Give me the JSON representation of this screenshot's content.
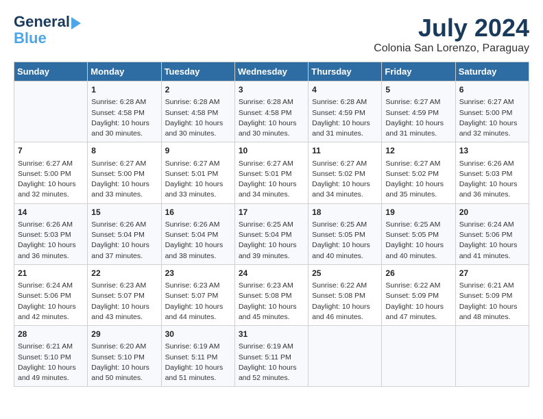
{
  "logo": {
    "line1": "General",
    "line2": "Blue"
  },
  "title": "July 2024",
  "location": "Colonia San Lorenzo, Paraguay",
  "days_of_week": [
    "Sunday",
    "Monday",
    "Tuesday",
    "Wednesday",
    "Thursday",
    "Friday",
    "Saturday"
  ],
  "weeks": [
    [
      {
        "day": "",
        "text": ""
      },
      {
        "day": "1",
        "text": "Sunrise: 6:28 AM\nSunset: 4:58 PM\nDaylight: 10 hours\nand 30 minutes."
      },
      {
        "day": "2",
        "text": "Sunrise: 6:28 AM\nSunset: 4:58 PM\nDaylight: 10 hours\nand 30 minutes."
      },
      {
        "day": "3",
        "text": "Sunrise: 6:28 AM\nSunset: 4:58 PM\nDaylight: 10 hours\nand 30 minutes."
      },
      {
        "day": "4",
        "text": "Sunrise: 6:28 AM\nSunset: 4:59 PM\nDaylight: 10 hours\nand 31 minutes."
      },
      {
        "day": "5",
        "text": "Sunrise: 6:27 AM\nSunset: 4:59 PM\nDaylight: 10 hours\nand 31 minutes."
      },
      {
        "day": "6",
        "text": "Sunrise: 6:27 AM\nSunset: 5:00 PM\nDaylight: 10 hours\nand 32 minutes."
      }
    ],
    [
      {
        "day": "7",
        "text": "Sunrise: 6:27 AM\nSunset: 5:00 PM\nDaylight: 10 hours\nand 32 minutes."
      },
      {
        "day": "8",
        "text": "Sunrise: 6:27 AM\nSunset: 5:00 PM\nDaylight: 10 hours\nand 33 minutes."
      },
      {
        "day": "9",
        "text": "Sunrise: 6:27 AM\nSunset: 5:01 PM\nDaylight: 10 hours\nand 33 minutes."
      },
      {
        "day": "10",
        "text": "Sunrise: 6:27 AM\nSunset: 5:01 PM\nDaylight: 10 hours\nand 34 minutes."
      },
      {
        "day": "11",
        "text": "Sunrise: 6:27 AM\nSunset: 5:02 PM\nDaylight: 10 hours\nand 34 minutes."
      },
      {
        "day": "12",
        "text": "Sunrise: 6:27 AM\nSunset: 5:02 PM\nDaylight: 10 hours\nand 35 minutes."
      },
      {
        "day": "13",
        "text": "Sunrise: 6:26 AM\nSunset: 5:03 PM\nDaylight: 10 hours\nand 36 minutes."
      }
    ],
    [
      {
        "day": "14",
        "text": "Sunrise: 6:26 AM\nSunset: 5:03 PM\nDaylight: 10 hours\nand 36 minutes."
      },
      {
        "day": "15",
        "text": "Sunrise: 6:26 AM\nSunset: 5:04 PM\nDaylight: 10 hours\nand 37 minutes."
      },
      {
        "day": "16",
        "text": "Sunrise: 6:26 AM\nSunset: 5:04 PM\nDaylight: 10 hours\nand 38 minutes."
      },
      {
        "day": "17",
        "text": "Sunrise: 6:25 AM\nSunset: 5:04 PM\nDaylight: 10 hours\nand 39 minutes."
      },
      {
        "day": "18",
        "text": "Sunrise: 6:25 AM\nSunset: 5:05 PM\nDaylight: 10 hours\nand 40 minutes."
      },
      {
        "day": "19",
        "text": "Sunrise: 6:25 AM\nSunset: 5:05 PM\nDaylight: 10 hours\nand 40 minutes."
      },
      {
        "day": "20",
        "text": "Sunrise: 6:24 AM\nSunset: 5:06 PM\nDaylight: 10 hours\nand 41 minutes."
      }
    ],
    [
      {
        "day": "21",
        "text": "Sunrise: 6:24 AM\nSunset: 5:06 PM\nDaylight: 10 hours\nand 42 minutes."
      },
      {
        "day": "22",
        "text": "Sunrise: 6:23 AM\nSunset: 5:07 PM\nDaylight: 10 hours\nand 43 minutes."
      },
      {
        "day": "23",
        "text": "Sunrise: 6:23 AM\nSunset: 5:07 PM\nDaylight: 10 hours\nand 44 minutes."
      },
      {
        "day": "24",
        "text": "Sunrise: 6:23 AM\nSunset: 5:08 PM\nDaylight: 10 hours\nand 45 minutes."
      },
      {
        "day": "25",
        "text": "Sunrise: 6:22 AM\nSunset: 5:08 PM\nDaylight: 10 hours\nand 46 minutes."
      },
      {
        "day": "26",
        "text": "Sunrise: 6:22 AM\nSunset: 5:09 PM\nDaylight: 10 hours\nand 47 minutes."
      },
      {
        "day": "27",
        "text": "Sunrise: 6:21 AM\nSunset: 5:09 PM\nDaylight: 10 hours\nand 48 minutes."
      }
    ],
    [
      {
        "day": "28",
        "text": "Sunrise: 6:21 AM\nSunset: 5:10 PM\nDaylight: 10 hours\nand 49 minutes."
      },
      {
        "day": "29",
        "text": "Sunrise: 6:20 AM\nSunset: 5:10 PM\nDaylight: 10 hours\nand 50 minutes."
      },
      {
        "day": "30",
        "text": "Sunrise: 6:19 AM\nSunset: 5:11 PM\nDaylight: 10 hours\nand 51 minutes."
      },
      {
        "day": "31",
        "text": "Sunrise: 6:19 AM\nSunset: 5:11 PM\nDaylight: 10 hours\nand 52 minutes."
      },
      {
        "day": "",
        "text": ""
      },
      {
        "day": "",
        "text": ""
      },
      {
        "day": "",
        "text": ""
      }
    ]
  ]
}
